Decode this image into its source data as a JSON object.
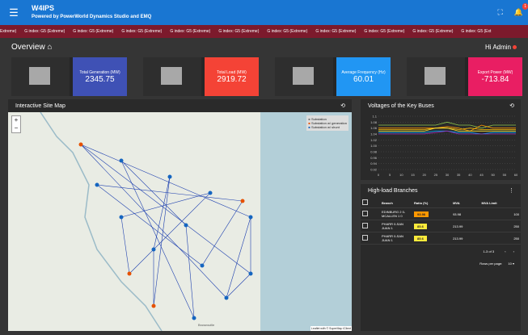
{
  "app": {
    "title": "W4IPS",
    "subtitle": "Powered by PowerWorld Dynamics Studio and EMQ",
    "notification_count": "1"
  },
  "ticker": [
    "Extreme)",
    "G index: G5 (Extreme)",
    "G index: G5 (Extreme)",
    "G index: G5 (Extreme)",
    "G index: G5 (Extreme)",
    "G index: G5 (Extreme)",
    "G index: G5 (Extreme)",
    "G index: G5 (Extreme)",
    "G index: G5 (Extreme)",
    "G index: G5 (Extreme)",
    "G index: G5 (Ext"
  ],
  "overview": {
    "title": "Overview",
    "greeting": "Hi Admin"
  },
  "cards": [
    {
      "label": "Total Generation (MW)",
      "value": "2345.75",
      "color": "#3f51b5"
    },
    {
      "label": "Total Load (MW)",
      "value": "2919.72",
      "color": "#f44336"
    },
    {
      "label": "Average Frequency (Hz)",
      "value": "60.01",
      "color": "#2196f3"
    },
    {
      "label": "Export Power (MW)",
      "value": "-713.84",
      "color": "#e91e63"
    }
  ],
  "site_map": {
    "title": "Interactive Site Map",
    "legend": [
      "Substation",
      "Substation w/ generation",
      "Substation w/ shunt"
    ],
    "credit": "Leaflet with © SuperMap iClient",
    "city": "Brownsville"
  },
  "voltages": {
    "title": "Voltages of the Key Buses"
  },
  "chart_data": {
    "type": "line",
    "x": [
      0,
      5,
      10,
      15,
      20,
      25,
      30,
      35,
      40,
      45,
      50,
      55,
      60
    ],
    "ylim": [
      0.92,
      1.1
    ],
    "yticks": [
      "1.1",
      "1.08",
      "1.06",
      "1.04",
      "1.02",
      "1.00",
      "0.98",
      "0.96",
      "0.94",
      "0.92"
    ],
    "xticks": [
      "0",
      "5",
      "10",
      "15",
      "20",
      "25",
      "30",
      "35",
      "40",
      "45",
      "50",
      "55",
      "60"
    ],
    "series": [
      {
        "color": "#8bc34a",
        "values": [
          1.07,
          1.07,
          1.07,
          1.07,
          1.07,
          1.07,
          1.08,
          1.07,
          1.07,
          1.06,
          1.07,
          1.07,
          1.07
        ]
      },
      {
        "color": "#ff9800",
        "values": [
          1.06,
          1.06,
          1.06,
          1.06,
          1.06,
          1.06,
          1.065,
          1.06,
          1.05,
          1.07,
          1.06,
          1.06,
          1.06
        ]
      },
      {
        "color": "#ffc107",
        "values": [
          1.055,
          1.055,
          1.055,
          1.055,
          1.055,
          1.06,
          1.06,
          1.055,
          1.06,
          1.055,
          1.055,
          1.055,
          1.055
        ]
      },
      {
        "color": "#ffeb3b",
        "values": [
          1.05,
          1.05,
          1.05,
          1.05,
          1.05,
          1.06,
          1.06,
          1.05,
          1.05,
          1.05,
          1.05,
          1.05,
          1.05
        ]
      },
      {
        "color": "#03a9f4",
        "values": [
          1.045,
          1.045,
          1.045,
          1.045,
          1.045,
          1.05,
          1.05,
          1.045,
          1.045,
          1.04,
          1.045,
          1.045,
          1.045
        ]
      },
      {
        "color": "#9c27b0",
        "values": [
          1.04,
          1.04,
          1.04,
          1.04,
          1.04,
          1.045,
          1.05,
          1.04,
          1.04,
          1.04,
          1.04,
          1.04,
          1.04
        ]
      }
    ]
  },
  "branches": {
    "title": "High-load Branches",
    "columns": [
      "Branch",
      "Ratio (%)",
      "MVA",
      "MVA Limit"
    ],
    "rows": [
      {
        "branch": "EDINBURG 2 0-MCALLEN 1 0",
        "ratio": "93.98",
        "mva": "93.98",
        "limit": "100",
        "color": "#ff9800"
      },
      {
        "branch": "PHARR 0-SAN JUAN 1",
        "ratio": "85.6",
        "mva": "213.99",
        "limit": "250",
        "color": "#ffeb3b"
      },
      {
        "branch": "PHARR 0-SAN JUAN 1",
        "ratio": "85.6",
        "mva": "213.99",
        "limit": "250",
        "color": "#ffeb3b"
      }
    ],
    "pagination": "1-3 of 3",
    "rows_per_page_label": "Rows per page:",
    "rows_per_page": "10"
  }
}
